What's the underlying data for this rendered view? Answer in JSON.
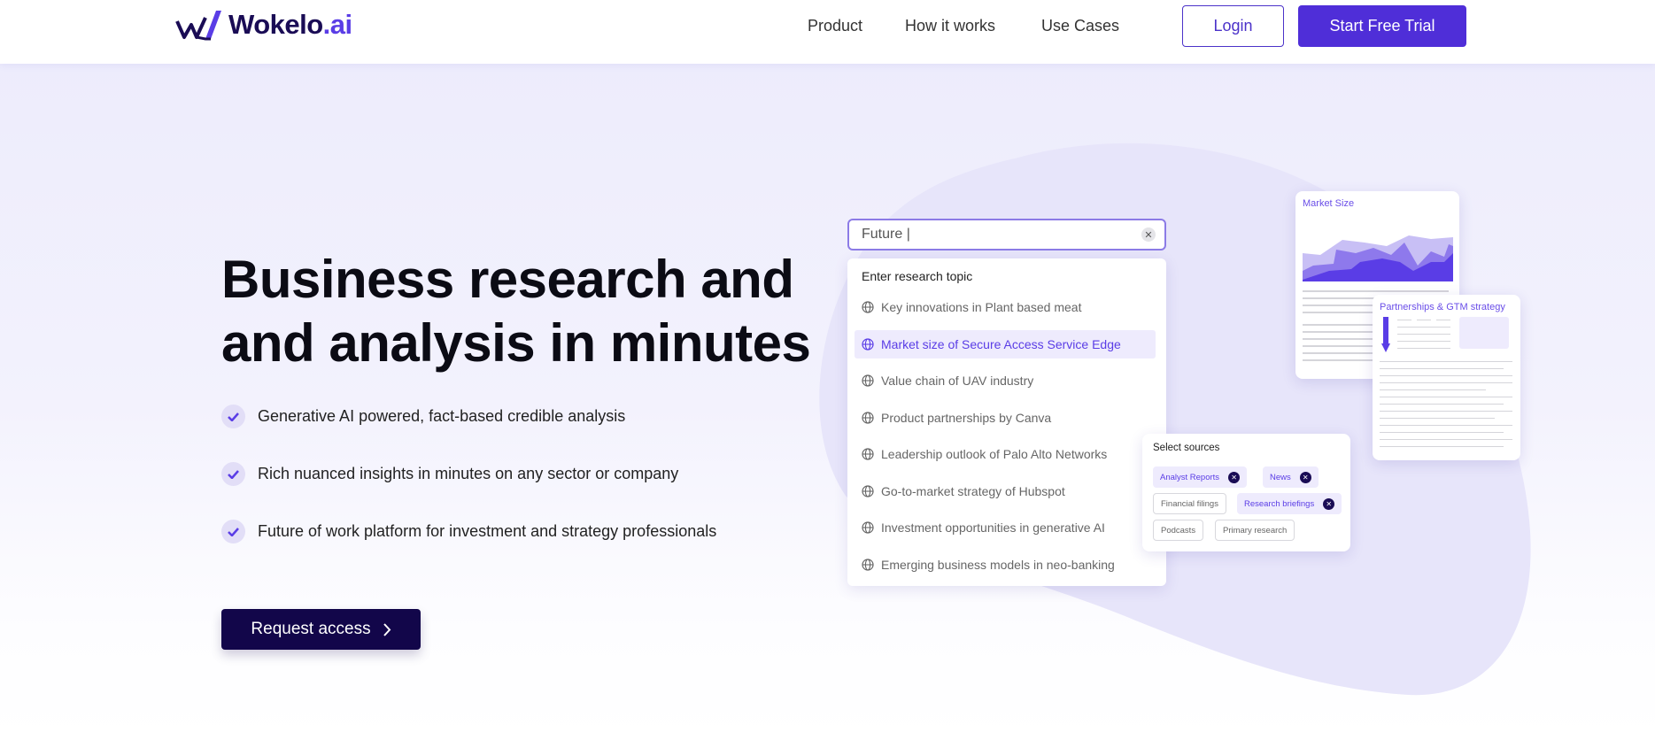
{
  "header": {
    "logo_main": "Wokelo",
    "logo_suffix": ".ai",
    "nav": [
      "Product",
      "How it works",
      "Use Cases"
    ],
    "login_label": "Login",
    "trial_label": "Start Free Trial"
  },
  "hero": {
    "headline_line1": "Business research and",
    "headline_line2": "and analysis in minutes",
    "bullets": [
      "Generative AI powered, fact-based credible analysis",
      "Rich nuanced insights in minutes on any sector or company",
      "Future of work platform for investment and strategy professionals"
    ],
    "cta_label": "Request access"
  },
  "search": {
    "value": "Future |",
    "dropdown_title": "Enter research topic",
    "items": [
      "Key innovations in Plant based meat",
      "Market size of Secure Access Service Edge",
      "Value chain of UAV industry",
      "Product partnerships by Canva",
      "Leadership outlook of Palo Alto Networks",
      "Go-to-market strategy of Hubspot",
      "Investment opportunities in generative AI",
      "Emerging business models in neo-banking"
    ],
    "active_index": 1
  },
  "market_card": {
    "title": "Market Size"
  },
  "partner_card": {
    "title": "Partnerships & GTM strategy"
  },
  "sources": {
    "title": "Select sources",
    "chips": [
      {
        "label": "Analyst Reports",
        "selected": true
      },
      {
        "label": "News",
        "selected": true
      },
      {
        "label": "Financial filings",
        "selected": false
      },
      {
        "label": "Research briefings",
        "selected": true
      },
      {
        "label": "Podcasts",
        "selected": false
      },
      {
        "label": "Primary research",
        "selected": false
      }
    ]
  },
  "colors": {
    "accent": "#4F2ED8",
    "dark": "#12064A",
    "lavender": "#ECEBFC"
  }
}
